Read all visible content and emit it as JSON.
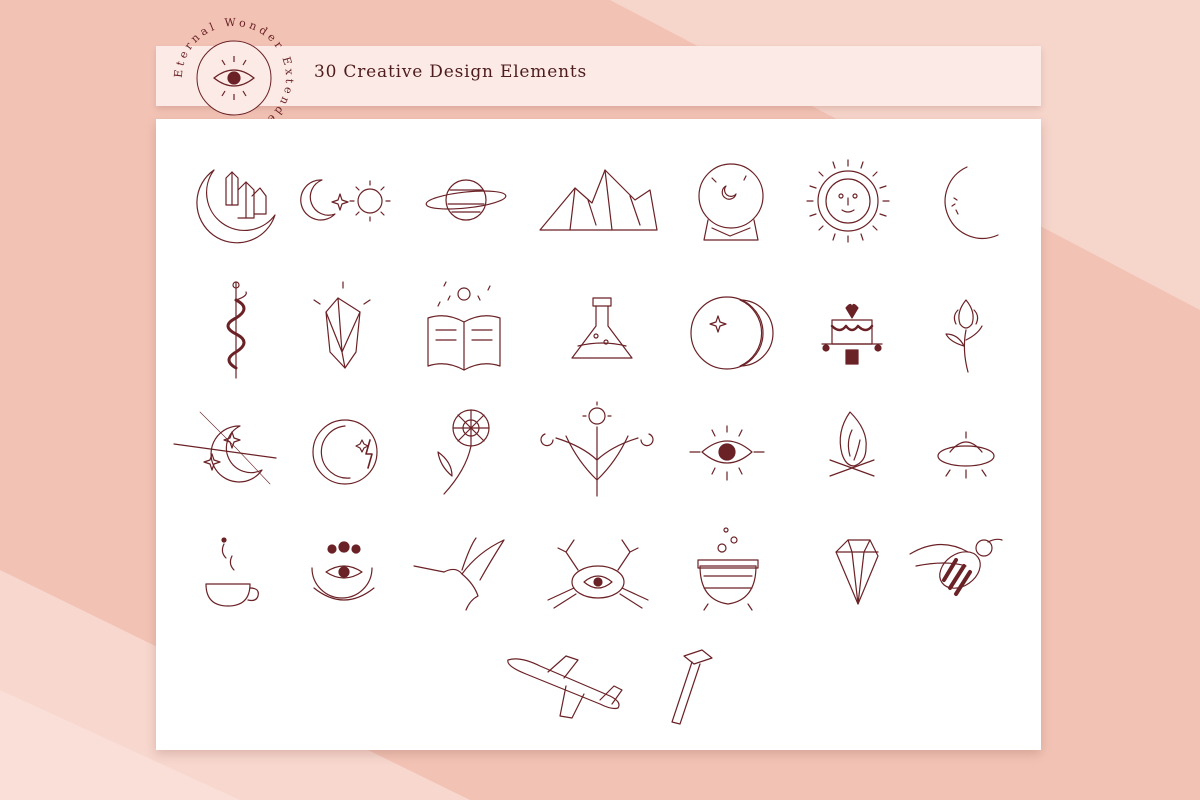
{
  "header": {
    "title": "30 Creative Design Elements"
  },
  "badge": {
    "ring_text": "Eternal Wonder Extended Pack",
    "icon": "eye-icon"
  },
  "colors": {
    "ink": "#6b2226",
    "background": "#f2c3b5",
    "header": "#fbeae5",
    "sheet": "#ffffff"
  },
  "elements": [
    "crystals-moon-icon",
    "moon-star-sun-icon",
    "planet-icon",
    "mountains-icon",
    "crystal-ball-icon",
    "sun-face-icon",
    "crescent-face-icon",
    "snake-staff-icon",
    "crystal-icon",
    "magic-book-icon",
    "potion-flask-icon",
    "moon-face-icon",
    "cake-icon",
    "flower-icon",
    "moon-stars-icon",
    "moon-lightning-icon",
    "daisy-icon",
    "plant-sun-icon",
    "eye-icon",
    "campfire-icon",
    "ufo-icon",
    "coffee-cup-icon",
    "moon-eye-icon",
    "hummingbird-icon",
    "crab-icon",
    "cauldron-icon",
    "gem-icon",
    "bee-icon",
    "airplane-icon",
    "hammer-icon"
  ]
}
